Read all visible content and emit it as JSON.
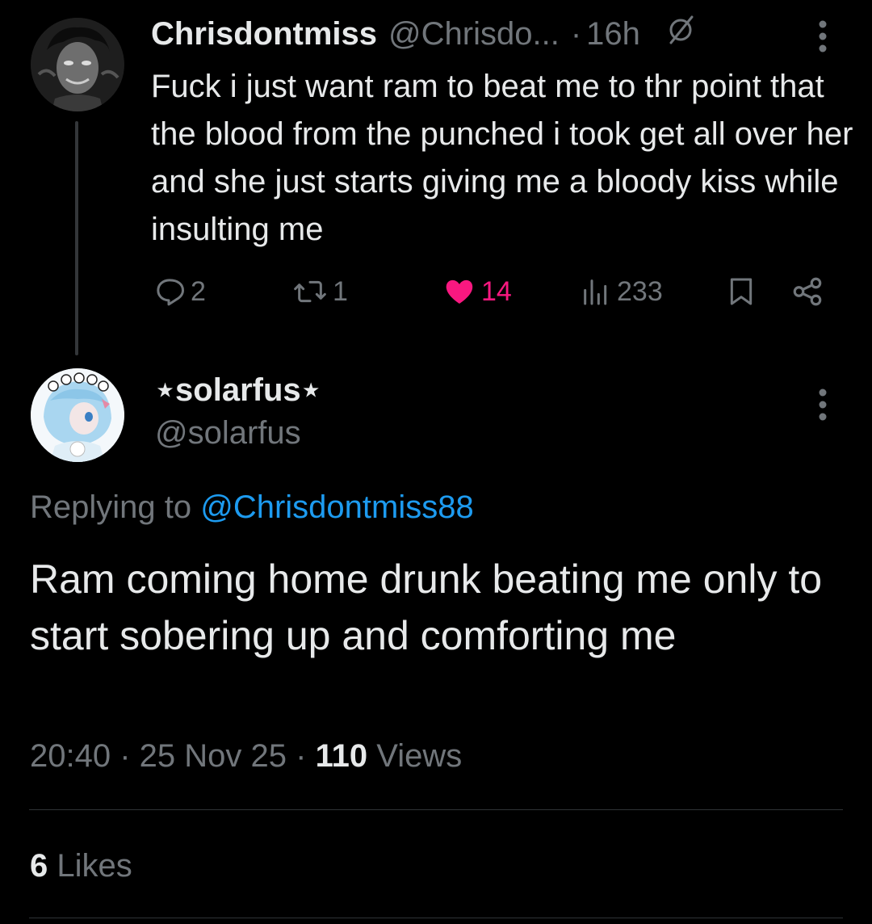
{
  "parent": {
    "name": "Chrisdontmiss",
    "handle": "@Chrisdo...",
    "dot": "·",
    "time": "16h",
    "text": "Fuck i just want ram to beat me to thr point that the blood from the punched i took get all over her and she just starts giving me a bloody kiss while insulting me",
    "replies": "2",
    "reposts": "1",
    "likes": "14",
    "views": "233"
  },
  "reply": {
    "name": "⋆solarfus⋆",
    "handle": "@solarfus",
    "replying_prefix": "Replying to ",
    "replying_handle": "@Chrisdontmiss88",
    "text": "Ram coming home drunk beating me only to start sobering up and comforting me",
    "time": "20:40",
    "date": "25 Nov 25",
    "views_count": "110",
    "views_label": "Views",
    "likes_count": "6",
    "likes_label": "Likes"
  },
  "icons": {
    "reply": "reply-icon",
    "repost": "repost-icon",
    "like": "heart-filled-icon",
    "views": "views-icon",
    "bookmark": "bookmark-icon",
    "share": "share-icon",
    "more": "more-vertical-icon",
    "grok": "slashed-circle-icon"
  },
  "colors": {
    "background": "#000000",
    "text": "#e7e9ea",
    "secondary": "#71767b",
    "link": "#1d9bf0",
    "like": "#f91880",
    "divider": "#2f3336"
  }
}
